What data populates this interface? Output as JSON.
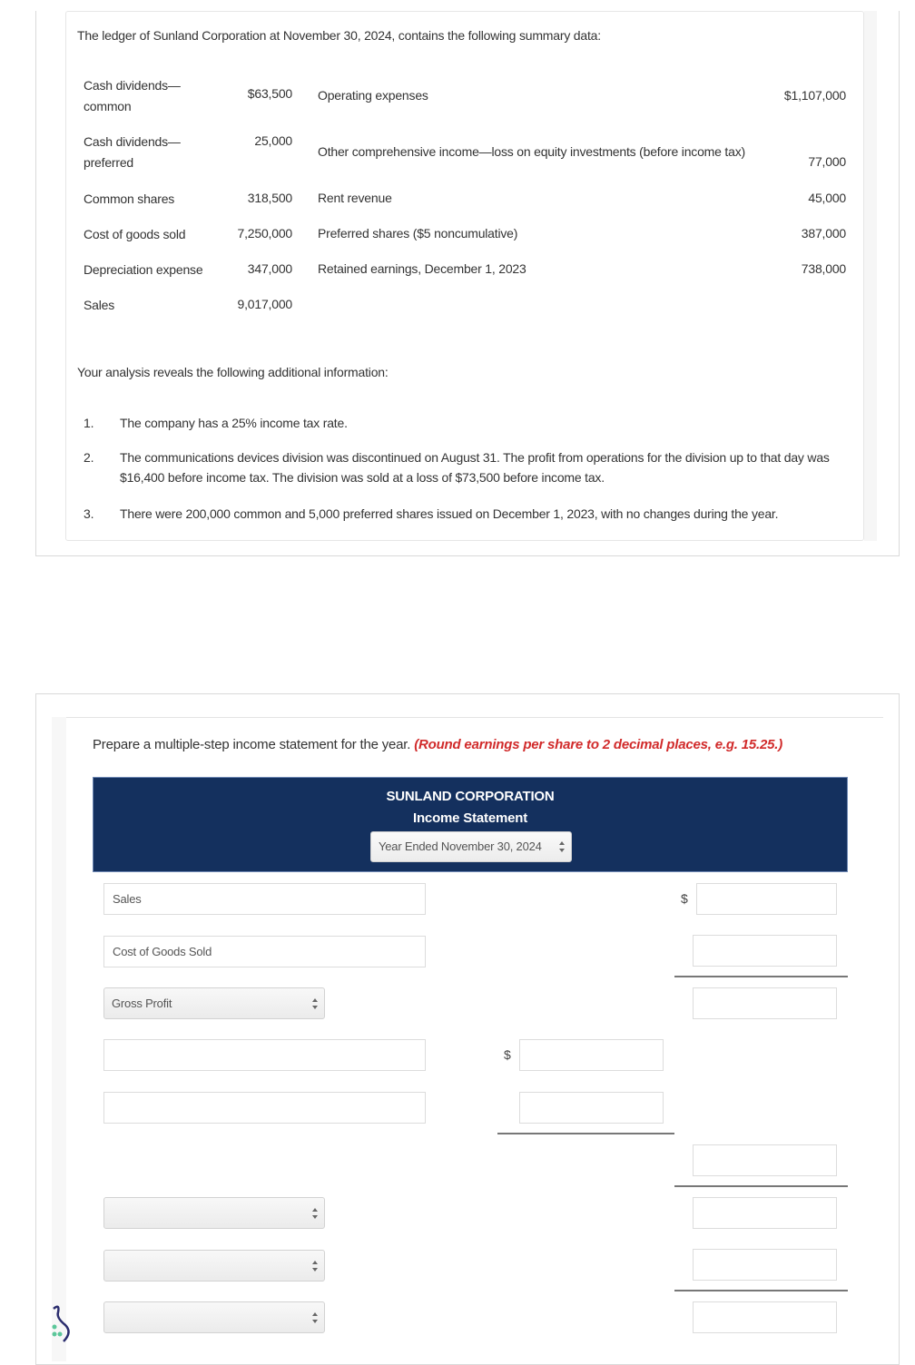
{
  "problem": {
    "intro": "The ledger of Sunland Corporation at November 30, 2024, contains the following summary data:",
    "ledger_left": [
      {
        "label_line1": "Cash dividends—",
        "label_line2": "common",
        "amount": "$63,500"
      },
      {
        "label_line1": "Cash dividends—",
        "label_line2": "preferred",
        "amount": "25,000"
      },
      {
        "label_line1": "Common shares",
        "label_line2": "",
        "amount": "318,500"
      },
      {
        "label_line1": "Cost of goods sold",
        "label_line2": "",
        "amount": "7,250,000"
      },
      {
        "label_line1": "Depreciation expense",
        "label_line2": "",
        "amount": "347,000"
      },
      {
        "label_line1": "Sales",
        "label_line2": "",
        "amount": "9,017,000"
      }
    ],
    "ledger_right": [
      {
        "label": "Operating expenses",
        "amount": "$1,107,000"
      },
      {
        "label": "Other comprehensive income—loss on equity investments (before income tax)",
        "amount": "77,000"
      },
      {
        "label": "Rent revenue",
        "amount": "45,000"
      },
      {
        "label": "Preferred shares ($5 noncumulative)",
        "amount": "387,000"
      },
      {
        "label": "Retained earnings, December 1, 2023",
        "amount": "738,000"
      }
    ],
    "additional_intro": "Your analysis reveals the following additional information:",
    "notes": [
      {
        "num": "1.",
        "text": "The company has a 25% income tax rate."
      },
      {
        "num": "2.",
        "text": "The communications devices division was discontinued on August 31. The profit from operations for the division up to that day was $16,400 before income tax. The division was sold at a loss of $73,500 before income tax."
      },
      {
        "num": "3.",
        "text": "There were 200,000 common and 5,000 preferred shares issued on December 1, 2023, with no changes during the year."
      }
    ]
  },
  "task": {
    "instruction": "Prepare a multiple-step income statement for the year.",
    "instruction_note": "(Round earnings per share to 2 decimal places, e.g. 15.25.)",
    "accent_color": "#d12b2b"
  },
  "statement": {
    "header_color": "#14305e",
    "company": "SUNLAND CORPORATION",
    "title": "Income Statement",
    "period_selected": "Year Ended November 30, 2024",
    "currency_symbol": "$",
    "rows": [
      {
        "label": "Sales",
        "type": "text",
        "value": ""
      },
      {
        "label": "Cost of Goods Sold",
        "type": "text",
        "value": ""
      },
      {
        "label": "Gross Profit",
        "type": "select",
        "value": ""
      },
      {
        "label": "",
        "type": "text",
        "value": ""
      },
      {
        "label": "",
        "type": "text",
        "value": ""
      },
      {
        "label": "",
        "type": "select",
        "value": ""
      },
      {
        "label": "",
        "type": "select",
        "value": ""
      },
      {
        "label": "",
        "type": "select",
        "value": ""
      }
    ]
  }
}
